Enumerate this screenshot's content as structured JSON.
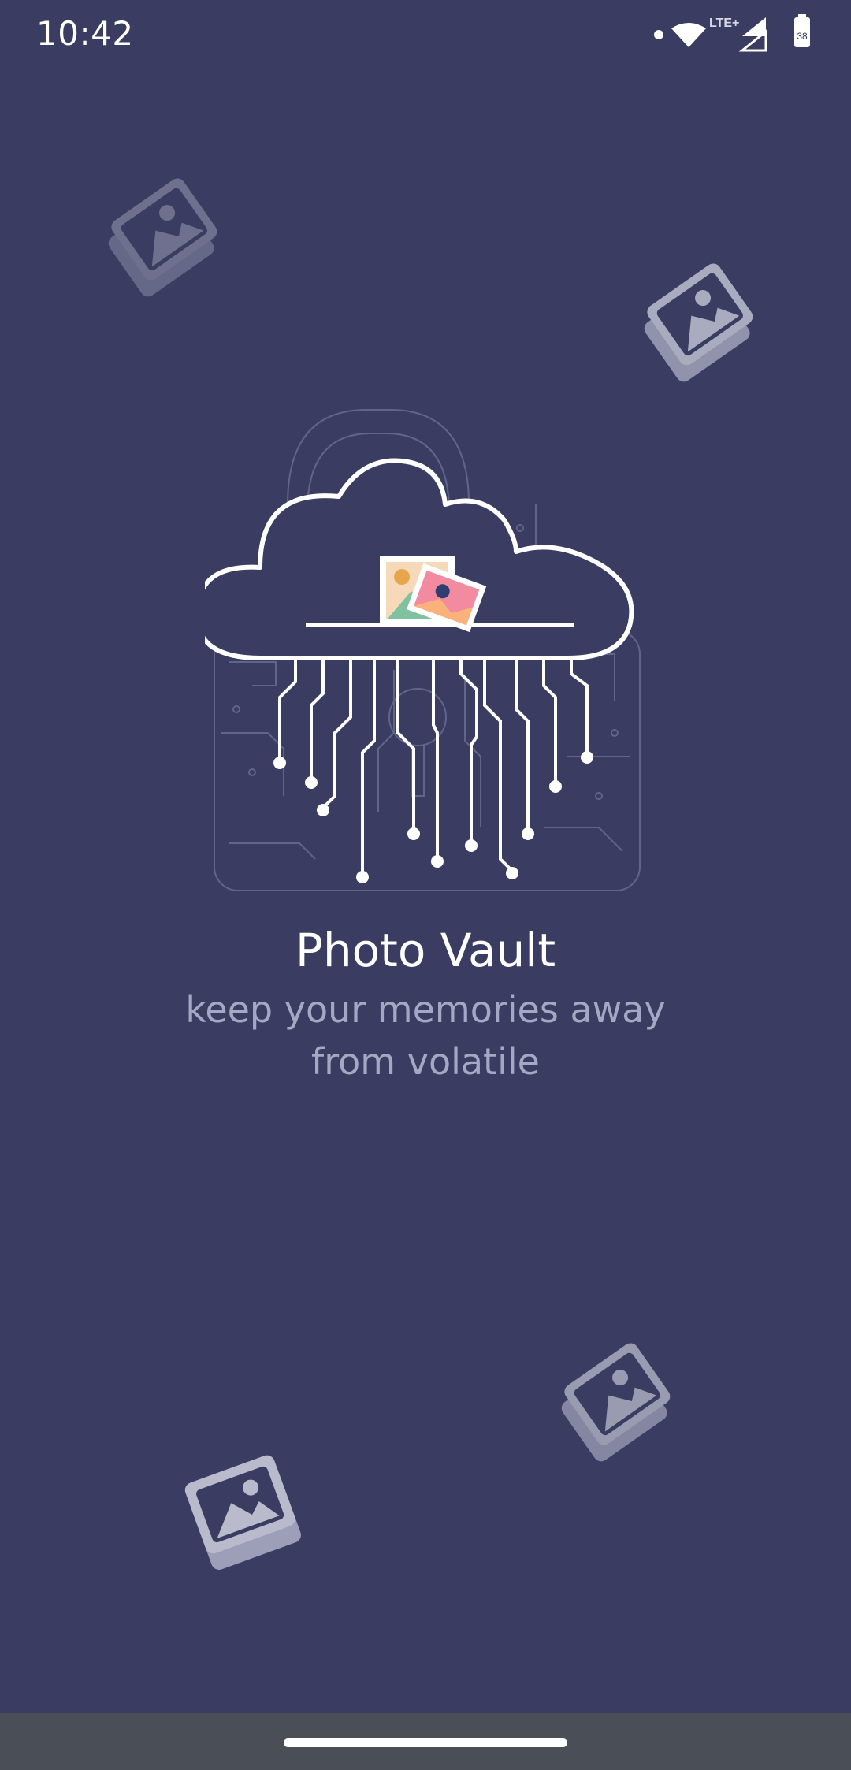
{
  "status_bar": {
    "time": "10:42",
    "network_label": "LTE+",
    "icons": [
      "notification-dot-icon",
      "wifi-icon",
      "signal-icon",
      "signal-icon",
      "battery-icon"
    ]
  },
  "app": {
    "title": "Photo Vault",
    "subtitle_line1": "keep your memories away",
    "subtitle_line2": "from volatile"
  },
  "colors": {
    "background": "#3a3d61",
    "accent_text": "#ffffff",
    "muted_text": "#a6a8c3",
    "nav_bar": "#4a4f57"
  },
  "decorations": [
    "photo-stack-icon",
    "photo-stack-icon",
    "photo-stack-icon",
    "photo-stack-icon"
  ]
}
